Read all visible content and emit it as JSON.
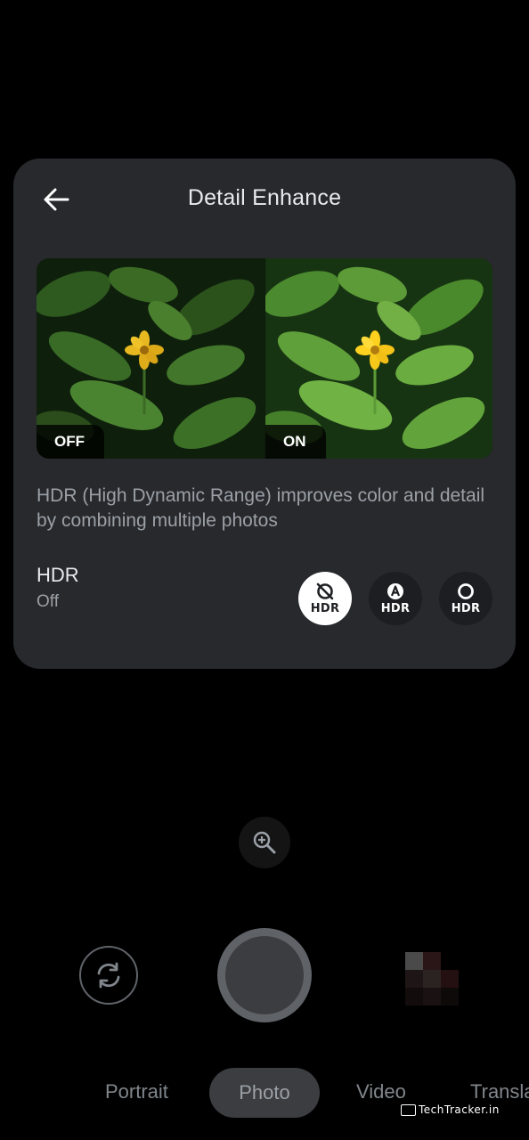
{
  "panel": {
    "title": "Detail Enhance",
    "back_icon": "arrow-back-icon",
    "compare": {
      "off_label": "OFF",
      "on_label": "ON"
    },
    "description": "HDR (High Dynamic Range) improves color and detail by combining multiple photos",
    "setting": {
      "label": "HDR",
      "value": "Off",
      "options": [
        {
          "icon": "hdr-off-icon",
          "label": "HDR",
          "selected": true
        },
        {
          "icon": "hdr-auto-icon",
          "label": "HDR",
          "selected": false
        },
        {
          "icon": "hdr-on-icon",
          "label": "HDR",
          "selected": false
        }
      ]
    }
  },
  "camera": {
    "zoom_icon": "zoom-in-icon",
    "switch_icon": "switch-camera-icon",
    "shutter_icon": "shutter-button",
    "thumbnail_icon": "gallery-thumbnail"
  },
  "modes": {
    "items": [
      "Portrait",
      "Photo",
      "Video",
      "Transla"
    ],
    "selected": "Photo"
  },
  "watermark": "TechTracker.in",
  "colors": {
    "panel_bg": "#28292d",
    "selected_option_bg": "#ffffff",
    "option_bg": "#1d1e21",
    "text_primary": "#e8eaed",
    "text_secondary": "#9aa0a6"
  }
}
